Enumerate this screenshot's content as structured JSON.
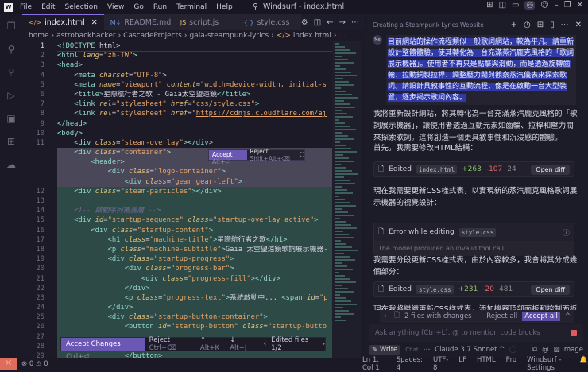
{
  "titlebar": {
    "menu": [
      "File",
      "Edit",
      "Selection",
      "View",
      "Go",
      "Run",
      "Terminal",
      "Help"
    ],
    "title": "Windsurf - index.html"
  },
  "tabs": [
    {
      "label": "index.html",
      "icon": "</>"
    },
    {
      "label": "README.md",
      "icon": "M↓"
    },
    {
      "label": "script.js",
      "icon": "JS"
    },
    {
      "label": "style.css",
      "icon": "{ }"
    }
  ],
  "breadcrumb": [
    "home",
    "astrobackhacker",
    "CascadeProjects",
    "gaia-steampunk-lyrics",
    "index.html",
    "..."
  ],
  "code": [
    {
      "n": "1",
      "k": "cur",
      "t": "<!DOCTYPE html>"
    },
    {
      "n": "2",
      "t": "<html lang=\"zh-TW\">"
    },
    {
      "n": "3",
      "t": "<head>"
    },
    {
      "n": "4",
      "t": "    <meta charset=\"UTF-8\">"
    },
    {
      "n": "5",
      "t": "    <meta name=\"viewport\" content=\"width=device-width, initial-s"
    },
    {
      "n": "6",
      "t": "    <title>星際航行者之歌 - Gaia太空望遠鏡</title>"
    },
    {
      "n": "7",
      "t": "    <link rel=\"stylesheet\" href=\"css/style.css\">"
    },
    {
      "n": "8",
      "t": "    <link rel=\"stylesheet\" href=\"https://cdnjs.cloudflare.com/aj"
    },
    {
      "n": "9",
      "t": "</head>"
    },
    {
      "n": "10",
      "t": "<body>"
    },
    {
      "n": "11",
      "t": "    <div class=\"steam-overlay\"></div>"
    },
    {
      "n": "",
      "k": "del",
      "t": "    <div class=\"container\">"
    },
    {
      "n": "",
      "k": "del",
      "t": "        <header>"
    },
    {
      "n": "",
      "k": "del",
      "t": "            <div class=\"logo-container\">"
    },
    {
      "n": "",
      "k": "del",
      "t": "                <div class=\"gear gear-left\">"
    },
    {
      "n": "12",
      "k": "add",
      "t": "    <div class=\"steam-particles\"></div>"
    },
    {
      "n": "13",
      "k": "add",
      "t": ""
    },
    {
      "n": "14",
      "k": "add",
      "t": "    <!-- 啟動序列覆蓋層 -->"
    },
    {
      "n": "15",
      "k": "add",
      "t": "    <div id=\"startup-sequence\" class=\"startup-overlay active\">"
    },
    {
      "n": "16",
      "k": "add",
      "t": "        <div class=\"startup-content\">"
    },
    {
      "n": "17",
      "k": "add",
      "t": "            <h1 class=\"machine-title\">星際航行者之歌</h1>"
    },
    {
      "n": "18",
      "k": "add",
      "t": "            <p class=\"machine-subtitle\">Gaia 太空望遠鏡歌詞展示機器-"
    },
    {
      "n": "19",
      "k": "add",
      "t": "            <div class=\"startup-progress\">"
    },
    {
      "n": "20",
      "k": "add",
      "t": "                <div class=\"progress-bar\">"
    },
    {
      "n": "21",
      "k": "add",
      "t": "                    <div class=\"progress-fill\"></div>"
    },
    {
      "n": "22",
      "k": "add",
      "t": "                </div>"
    },
    {
      "n": "23",
      "k": "add",
      "t": "                <p class=\"progress-text\">系統啟動中... <span id=\"p"
    },
    {
      "n": "24",
      "k": "add",
      "t": "            </div>"
    },
    {
      "n": "25",
      "k": "add",
      "t": "            <div class=\"startup-button-container\">"
    },
    {
      "n": "26",
      "k": "add",
      "t": "                <button id=\"startup-button\" class=\"startup-butto"
    },
    {
      "n": "27",
      "k": "add",
      "t": ""
    },
    {
      "n": "28",
      "k": "add",
      "t": ""
    },
    {
      "n": "29",
      "k": "add",
      "t": "                </button>"
    }
  ],
  "inline_review": {
    "accept": "Accept",
    "accept_key": "Alt+⏎",
    "reject": "Reject",
    "reject_key": "Shift+Alt+⌫"
  },
  "review_bar": {
    "accept": "Accept Changes",
    "accept_key": "Ctrl+⏎",
    "reject": "Reject",
    "reject_key": "Ctrl+⌫",
    "prev_key": "Alt+K",
    "next_key": "Alt+J",
    "files": "Edited files 1/2"
  },
  "statusbar": {
    "errors": "0",
    "warnings": "0",
    "position": "Ln 1, Col 1",
    "spaces": "Spaces: 4",
    "encoding": "UTF-8",
    "eol": "LF",
    "language": "HTML",
    "plan": "Pro",
    "settings": "Windsurf - Settings"
  },
  "chat": {
    "title": "Creating a Steampunk Lyrics Website",
    "avatar": "Me",
    "user_message": "目前網站的操作流程類似一般歌詞網站，較為平凡。請重新設計整體體驗，使其轉化為一台充滿蒸汽龐克風格的「歌詞展示機器」。使用者不再只是點擊與滑動，而是透過旋轉齒輪、拉動銅製拉桿、調整壓力閥與觀察蒸汽儀表來探索歌詞。請設計具敘事性的互動流程，像是在啟動一台大型裝置，逐步揭示歌詞內容。",
    "reply1": "我將重新設計網站，將其轉化為一台充滿蒸汽龐克風格的「歌詞展示機器」，讓使用者透過互動元素如齒輪、拉桿和壓力閥來探索歌詞。這將創造一個更具敘事性和沉浸感的體驗。",
    "reply2": "首先，我需要修改HTML結構：",
    "edit1": {
      "label": "Edited",
      "file": "index.html",
      "added": "+263",
      "removed": "-107",
      "count": "24",
      "button": "Open diff"
    },
    "reply3": "現在我需要更新CSS樣式表，以實現新的蒸汽龐克風格歌詞展示機器的視覺設計：",
    "error": {
      "label": "Error while editing",
      "file": "style.css",
      "detail": "The model produced an invalid tool call."
    },
    "reply4": "我需要分段更新CSS樣式表，由於內容較多，我會將其分成幾個部分：",
    "edit2": {
      "label": "Edited",
      "file": "style.css",
      "added": "+231",
      "removed": "-20",
      "count": "481",
      "button": "Open diff"
    },
    "reply5": "現在我將繼續更新CSS樣式表，添加機器頂部面板和控制面板的",
    "changes": {
      "label": "2 files with changes",
      "reject": "Reject all",
      "accept": "Accept all"
    },
    "input_placeholder": "Ask anything (Ctrl+L), @ to mention code blocks",
    "mode_write": "Write",
    "mode_chat": "Chat",
    "model": "Claude 3.7 Sonnet ^",
    "image": "Image"
  }
}
